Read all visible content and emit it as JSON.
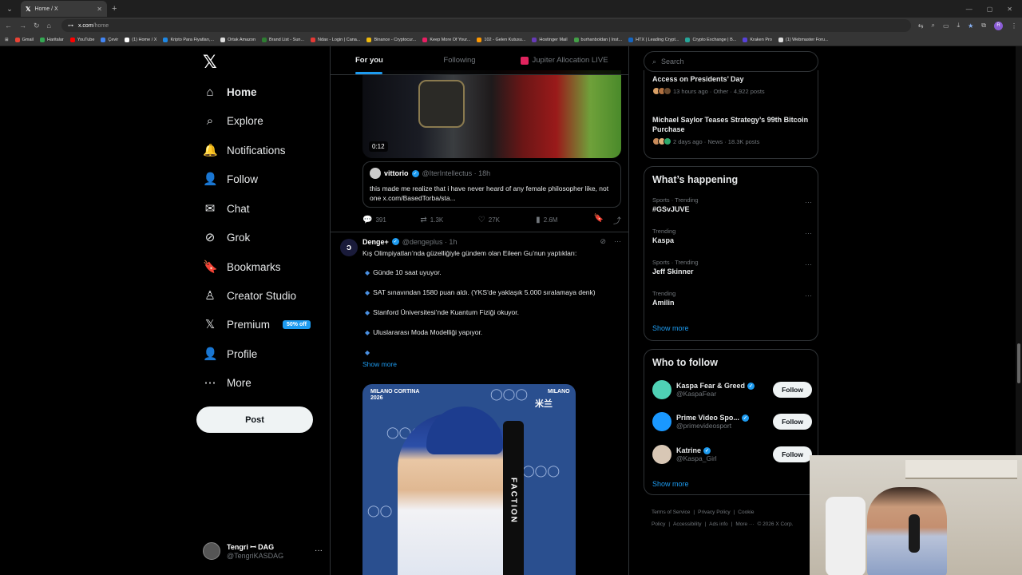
{
  "browser": {
    "tab_title": "Home / X",
    "url_host": "x.com",
    "url_path": "/home",
    "profile_initial": "R",
    "bookmarks": [
      {
        "label": "Gmail",
        "color": "#ea4335"
      },
      {
        "label": "Haritalar",
        "color": "#34a853"
      },
      {
        "label": "YouTube",
        "color": "#ff0000"
      },
      {
        "label": "Çevir",
        "color": "#4285f4"
      },
      {
        "label": "(1) Home / X",
        "color": "#ffffff"
      },
      {
        "label": "Kripto Para Fiyatları,...",
        "color": "#1e88e5"
      },
      {
        "label": "Ortak Amazon",
        "color": "#dddddd"
      },
      {
        "label": "Brand List - Sun...",
        "color": "#2e7d32"
      },
      {
        "label": "Ndax - Login | Cana...",
        "color": "#e53935"
      },
      {
        "label": "Binance - Cryptocur...",
        "color": "#f0b90b"
      },
      {
        "label": "Keep More Of Your...",
        "color": "#e91e63"
      },
      {
        "label": "102 - Gelen Kutusu...",
        "color": "#ff9800"
      },
      {
        "label": "Hostinger Mail",
        "color": "#673ab7"
      },
      {
        "label": "burhanboldan | Inst...",
        "color": "#43a047"
      },
      {
        "label": "HTX | Leading Crypt...",
        "color": "#1565c0"
      },
      {
        "label": "Crypto Exchange | B...",
        "color": "#26a69a"
      },
      {
        "label": "Kraken Pro",
        "color": "#5741d9"
      },
      {
        "label": "(1) Webmaster Foru...",
        "color": "#dddddd"
      }
    ]
  },
  "nav": {
    "items": [
      {
        "label": "Home",
        "icon": "⌂",
        "name": "home"
      },
      {
        "label": "Explore",
        "icon": "⌕",
        "name": "explore"
      },
      {
        "label": "Notifications",
        "icon": "🔔",
        "name": "notifications"
      },
      {
        "label": "Follow",
        "icon": "👤",
        "name": "follow"
      },
      {
        "label": "Chat",
        "icon": "✉",
        "name": "chat"
      },
      {
        "label": "Grok",
        "icon": "⊘",
        "name": "grok"
      },
      {
        "label": "Bookmarks",
        "icon": "🔖",
        "name": "bookmarks"
      },
      {
        "label": "Creator Studio",
        "icon": "♙",
        "name": "creator-studio"
      },
      {
        "label": "Premium",
        "icon": "𝕏",
        "name": "premium"
      },
      {
        "label": "Profile",
        "icon": "👤",
        "name": "profile"
      },
      {
        "label": "More",
        "icon": "⋯",
        "name": "more"
      }
    ],
    "premium_badge": "50% off",
    "post_label": "Post"
  },
  "account": {
    "name": "Tengri ꟷ DAG",
    "handle": "@TengriKASDAG"
  },
  "feed_tabs": {
    "for_you": "For you",
    "following": "Following",
    "live": "Jupiter Allocation LIVE"
  },
  "tweet1": {
    "video_duration": "0:12",
    "quote_name": "vittorio",
    "quote_handle": "@IterIntellectus · 18h",
    "quote_text": "this made me realize that i have never heard of any female philosopher like, not one x.com/BasedTorba/sta...",
    "replies": "391",
    "reposts": "1.3K",
    "likes": "27K",
    "views": "2.6M"
  },
  "tweet2": {
    "name": "Denge+",
    "handle": "@dengeplus · 1h",
    "avatar_letter": "ɔ",
    "intro": "Kış Olimpiyatları’nda güzelliğiyle gündem olan Eileen Gu’nun yaptıkları:",
    "bullets": [
      "Günde 10 saat uyuyor.",
      "SAT sınavından 1580 puan aldı. (YKS’de yaklaşık 5.000 sıralamaya denk)",
      "Stanford Üniversitesi’nde Kuantum Fiziği okuyor.",
      "Uluslararası Moda Modelliği yapıyor."
    ],
    "show_more": "Show more",
    "photo_brand": "MILANO CORTINA",
    "photo_year": "2026",
    "ski_text": "FACTION",
    "photo_brand_right": "MILANO",
    "photo_jp": "米兰"
  },
  "search": {
    "placeholder": "Search"
  },
  "news": [
    {
      "title": "Access on Presidents’ Day",
      "meta": "13 hours ago · Other · 4,922 posts"
    },
    {
      "title": "Michael Saylor Teases Strategy’s 99th Bitcoin Purchase",
      "meta": "2 days ago · News · 18.3K posts"
    }
  ],
  "happening": {
    "title": "What’s happening",
    "trends": [
      {
        "meta": "Sports · Trending",
        "name": "#GSvJUVE"
      },
      {
        "meta": "Trending",
        "name": "Kaspa"
      },
      {
        "meta": "Sports · Trending",
        "name": "Jeff Skinner"
      },
      {
        "meta": "Trending",
        "name": "Amilin"
      }
    ],
    "show_more": "Show more"
  },
  "who_to_follow": {
    "title": "Who to follow",
    "users": [
      {
        "name": "Kaspa Fear & Greed",
        "handle": "@KaspaFear",
        "color": "#4fd1b5"
      },
      {
        "name": "Prime Video Spo...",
        "handle": "@primevideosport",
        "color": "#1a98ff"
      },
      {
        "name": "Katrine",
        "handle": "@Kaspa_Girl",
        "color": "#d8c7b5"
      }
    ],
    "follow_label": "Follow",
    "show_more": "Show more"
  },
  "footer": {
    "links": [
      "Terms of Service",
      "|",
      "Privacy Policy",
      "|",
      "Cookie Policy",
      "|",
      "Accessibility",
      "|",
      "Ads info",
      "|",
      "More ···",
      "© 2026 X Corp."
    ]
  },
  "colors": {
    "accent": "#1d9bf0",
    "background": "#000000",
    "border": "#2f3336"
  }
}
